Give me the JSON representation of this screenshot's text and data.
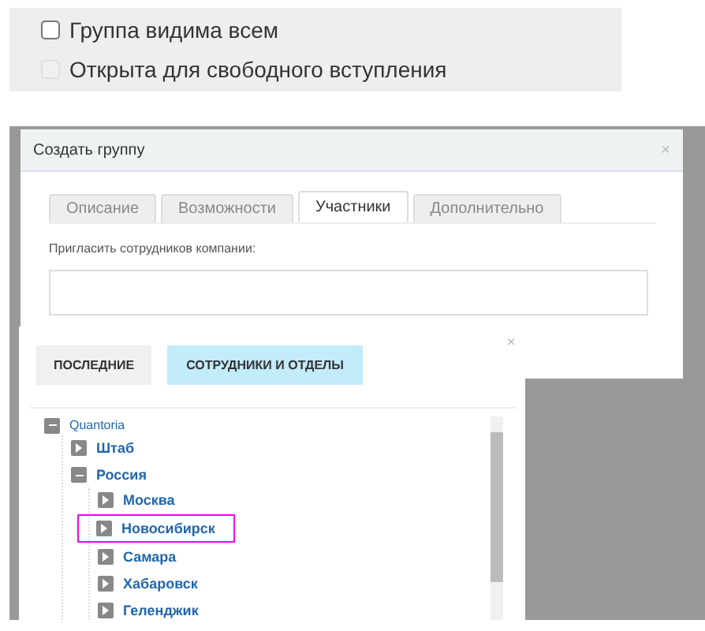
{
  "options": [
    {
      "label": "Группа видима всем",
      "checked": false,
      "disabled": false
    },
    {
      "label": "Открыта для свободного вступления",
      "checked": false,
      "disabled": true
    }
  ],
  "dialog": {
    "title": "Создать группу",
    "close": "×",
    "tabs": [
      {
        "label": "Описание",
        "selected": false
      },
      {
        "label": "Возможности",
        "selected": false
      },
      {
        "label": "Участники",
        "selected": true
      },
      {
        "label": "Дополнительно",
        "selected": false
      }
    ],
    "invite_label": "Пригласить сотрудников компании:"
  },
  "picker": {
    "close": "×",
    "tabs": [
      {
        "label": "ПОСЛЕДНИЕ",
        "selected": false
      },
      {
        "label": "СОТРУДНИКИ И ОТДЕЛЫ",
        "selected": true
      }
    ],
    "tree": [
      {
        "label": "Quantoria",
        "expanded": true,
        "highlighted": false,
        "children": [
          {
            "label": "Штаб",
            "expanded": false,
            "highlighted": false
          },
          {
            "label": "Россия",
            "expanded": true,
            "highlighted": false,
            "children": [
              {
                "label": "Москва",
                "expanded": false,
                "highlighted": false
              },
              {
                "label": "Новосибирск",
                "expanded": false,
                "highlighted": true
              },
              {
                "label": "Самара",
                "expanded": false,
                "highlighted": false
              },
              {
                "label": "Хабаровск",
                "expanded": false,
                "highlighted": false
              },
              {
                "label": "Геленджик",
                "expanded": false,
                "highlighted": false
              }
            ]
          }
        ]
      }
    ]
  }
}
